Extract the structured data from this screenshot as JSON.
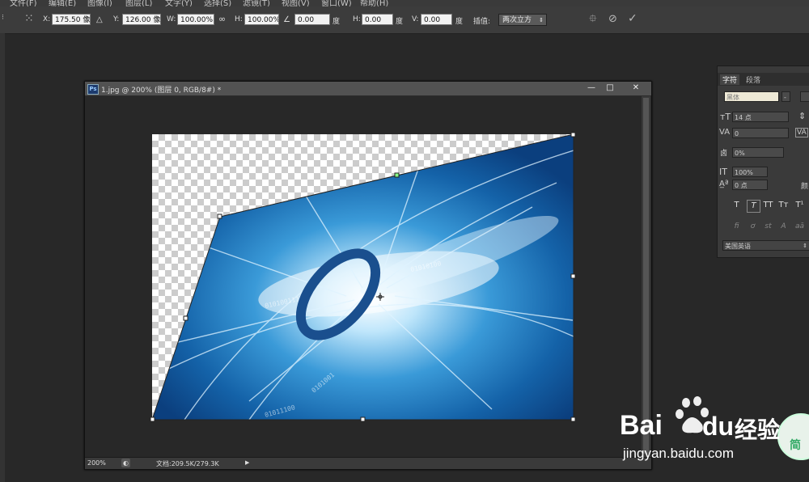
{
  "menubar": {
    "items": [
      "文件(F)",
      "编辑(E)",
      "图像(I)",
      "图层(L)",
      "文字(Y)",
      "选择(S)",
      "滤镜(T)",
      "视图(V)",
      "窗口(W)",
      "帮助(H)"
    ]
  },
  "options_bar": {
    "x_label": "X:",
    "x_value": "175.50 像素",
    "delta_icon": "△",
    "y_label": "Y:",
    "y_value": "126.00 像素",
    "w_label": "W:",
    "w_value": "100.00%",
    "link_icon": "∞",
    "h_label": "H:",
    "h_value": "100.00%",
    "angle_icon": "∠",
    "angle_value": "0.00",
    "angle_unit": "度",
    "hskew_label": "H:",
    "hskew_value": "0.00",
    "hskew_unit": "度",
    "vskew_label": "V:",
    "vskew_value": "0.00",
    "vskew_unit": "度",
    "interp_label": "插值:",
    "interp_value": "两次立方"
  },
  "document": {
    "title": "1.jpg @ 200% (图层 0, RGB/8#) *",
    "ps_badge": "Ps",
    "minimize": "—",
    "maximize": "□",
    "close": "✕",
    "zoom": "200%",
    "doc_info": "文档:209.5K/279.3K",
    "arrow": "▶"
  },
  "char_panel": {
    "tab_character": "字符",
    "tab_paragraph": "段落",
    "font_family": "黑体",
    "font_style": "-",
    "font_size": "14 点",
    "kerning": "0",
    "tracking": "0%",
    "vscale": "100%",
    "baseline": "0 点",
    "color_label": "颜",
    "type_buttons": [
      "T",
      "T",
      "TT",
      "Tт",
      "T¹"
    ],
    "opentype_buttons": [
      "fi",
      "ơ",
      "st",
      "A",
      "aā"
    ],
    "language": "美国英语"
  },
  "watermark": {
    "brand": "Bai",
    "brand2": "du",
    "suffix": "经验",
    "url": "jingyan.baidu.com",
    "badge_text": "简"
  },
  "colors": {
    "accent_blue": "#1b6fb8",
    "ui_dark": "#282828"
  }
}
